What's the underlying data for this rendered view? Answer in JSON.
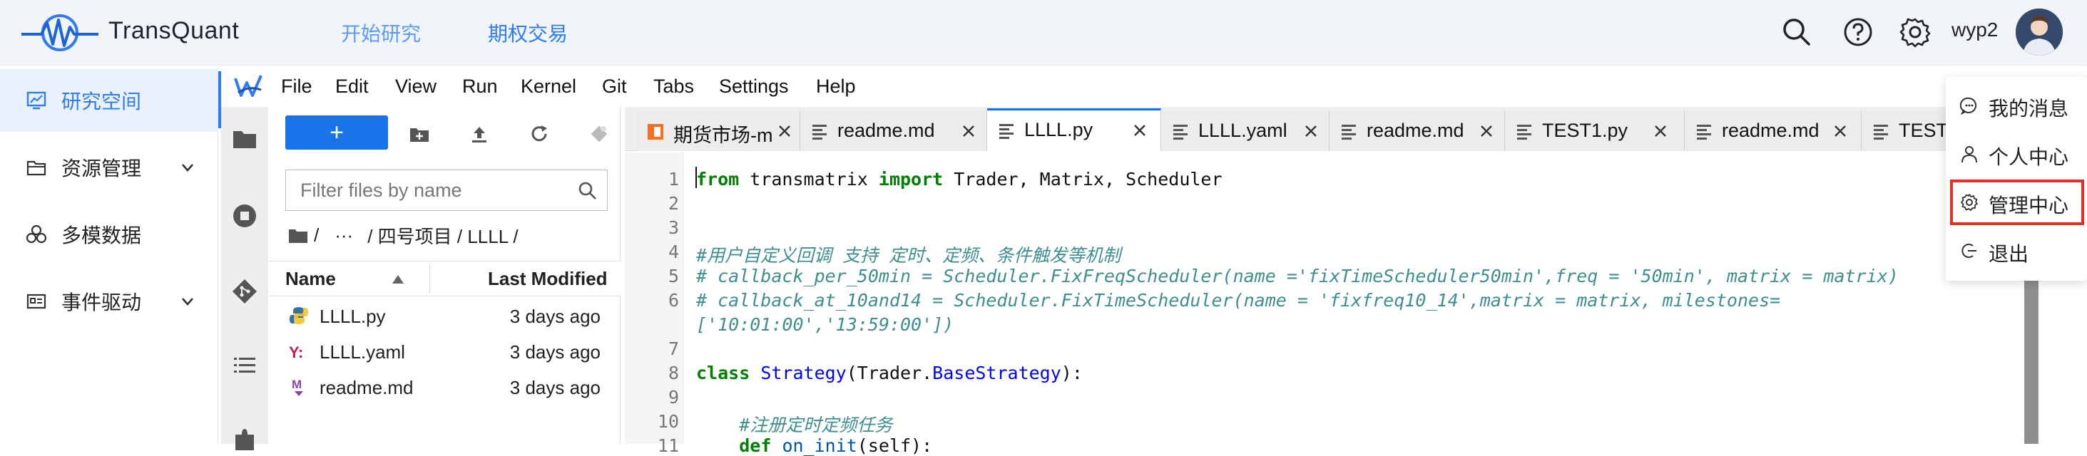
{
  "app": {
    "brand": "TransQuant",
    "nav": [
      "开始研究",
      "期权交易"
    ],
    "username": "wyp2"
  },
  "colors": {
    "accent": "#2f7bf3",
    "highlight": "#e0322b"
  },
  "sidebar": {
    "items": [
      {
        "label": "研究空间",
        "icon": "monitor-chart-icon",
        "active": true
      },
      {
        "label": "资源管理",
        "icon": "folder-icon",
        "expandable": true
      },
      {
        "label": "多模数据",
        "icon": "clover-icon"
      },
      {
        "label": "事件驱动",
        "icon": "id-card-icon",
        "expandable": true
      }
    ]
  },
  "jupyter": {
    "menu": [
      "File",
      "Edit",
      "View",
      "Run",
      "Kernel",
      "Git",
      "Tabs",
      "Settings",
      "Help"
    ],
    "filebrowser": {
      "new_label": "+",
      "filter_placeholder": "Filter files by name",
      "breadcrumb": [
        "/",
        "···",
        "/ 四号项目 / LLLL /"
      ],
      "col_name": "Name",
      "col_modified": "Last Modified",
      "files": [
        {
          "name": "LLLL.py",
          "modified": "3 days ago",
          "icon": "python-icon"
        },
        {
          "name": "LLLL.yaml",
          "modified": "3 days ago",
          "icon": "yaml-icon"
        },
        {
          "name": "readme.md",
          "modified": "3 days ago",
          "icon": "markdown-icon"
        }
      ]
    },
    "tabs": [
      {
        "label": "期货市场-ma",
        "icon": "notebook-icon"
      },
      {
        "label": "readme.md",
        "icon": "text-icon"
      },
      {
        "label": "LLLL.py",
        "icon": "text-icon",
        "active": true
      },
      {
        "label": "LLLL.yaml",
        "icon": "text-icon"
      },
      {
        "label": "readme.md",
        "icon": "text-icon"
      },
      {
        "label": "TEST1.py",
        "icon": "text-icon"
      },
      {
        "label": "readme.md",
        "icon": "text-icon"
      },
      {
        "label": "TEST",
        "icon": "text-icon"
      }
    ],
    "code_lines": [
      {
        "n": "1",
        "text": "from transmatrix import Trader, Matrix, Scheduler"
      },
      {
        "n": "2",
        "text": ""
      },
      {
        "n": "3",
        "text": ""
      },
      {
        "n": "4",
        "text": "#用户自定义回调 支持 定时、定频、条件触发等机制"
      },
      {
        "n": "5",
        "text": "# callback_per_50min = Scheduler.FixFreqScheduler(name ='fixTimeScheduler50min',freq = '50min', matrix = matrix)"
      },
      {
        "n": "6",
        "text": "# callback_at_10and14 = Scheduler.FixTimeScheduler(name = 'fixfreq10_14',matrix = matrix, milestones="
      },
      {
        "n": "",
        "text": "['10:01:00','13:59:00'])"
      },
      {
        "n": "7",
        "text": ""
      },
      {
        "n": "8",
        "text": "class Strategy(Trader.BaseStrategy):"
      },
      {
        "n": "9",
        "text": ""
      },
      {
        "n": "10",
        "text": "    #注册定时定频任务"
      },
      {
        "n": "11",
        "text": "    def on_init(self):"
      }
    ]
  },
  "user_menu": {
    "items": [
      {
        "label": "我的消息",
        "icon": "message-icon"
      },
      {
        "label": "个人中心",
        "icon": "user-icon"
      },
      {
        "label": "管理中心",
        "icon": "gear-icon",
        "highlighted": true
      },
      {
        "label": "退出",
        "icon": "logout-icon"
      }
    ]
  }
}
